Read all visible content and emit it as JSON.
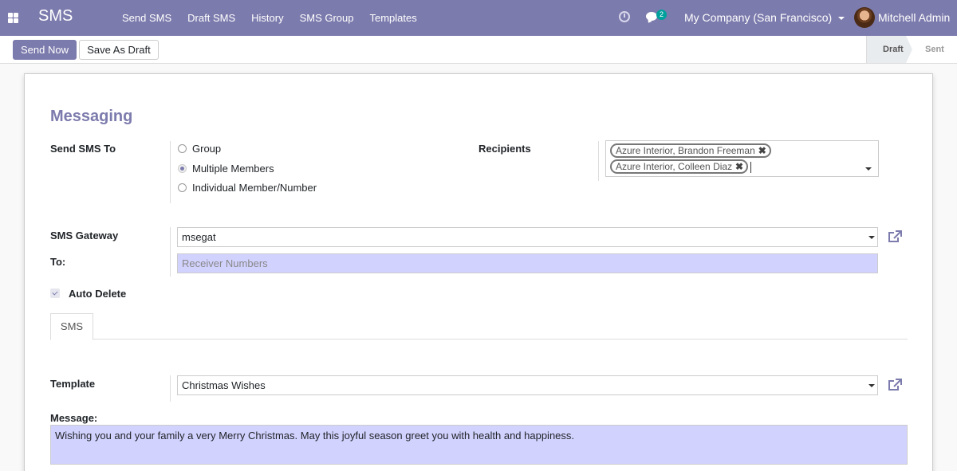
{
  "navbar": {
    "brand": "SMS",
    "menu": [
      "Send SMS",
      "Draft SMS",
      "History",
      "SMS Group",
      "Templates"
    ],
    "chat_count": "2",
    "company": "My Company (San Francisco)",
    "user": "Mitchell Admin"
  },
  "control": {
    "send_now": "Send Now",
    "save_draft": "Save As Draft",
    "status": [
      "Draft",
      "Sent"
    ]
  },
  "form": {
    "section_title": "Messaging",
    "send_to_label": "Send SMS To",
    "send_to_options": [
      "Group",
      "Multiple Members",
      "Individual Member/Number"
    ],
    "send_to_selected": "Multiple Members",
    "recipients_label": "Recipients",
    "recipients": [
      "Azure Interior, Brandon Freeman",
      "Azure Interior, Colleen Diaz"
    ],
    "gateway_label": "SMS Gateway",
    "gateway_value": "msegat",
    "to_label": "To:",
    "to_placeholder": "Receiver Numbers",
    "auto_delete_label": "Auto Delete",
    "auto_delete_checked": true,
    "tab": "SMS",
    "template_label": "Template",
    "template_value": "Christmas Wishes",
    "message_label": "Message:",
    "message_value": "Wishing you and your family a very Merry Christmas. May this joyful season greet you with health and happiness."
  },
  "colors": {
    "brand": "#7c7bad",
    "required_field": "#d2d2ff",
    "badge": "#00a09d"
  }
}
